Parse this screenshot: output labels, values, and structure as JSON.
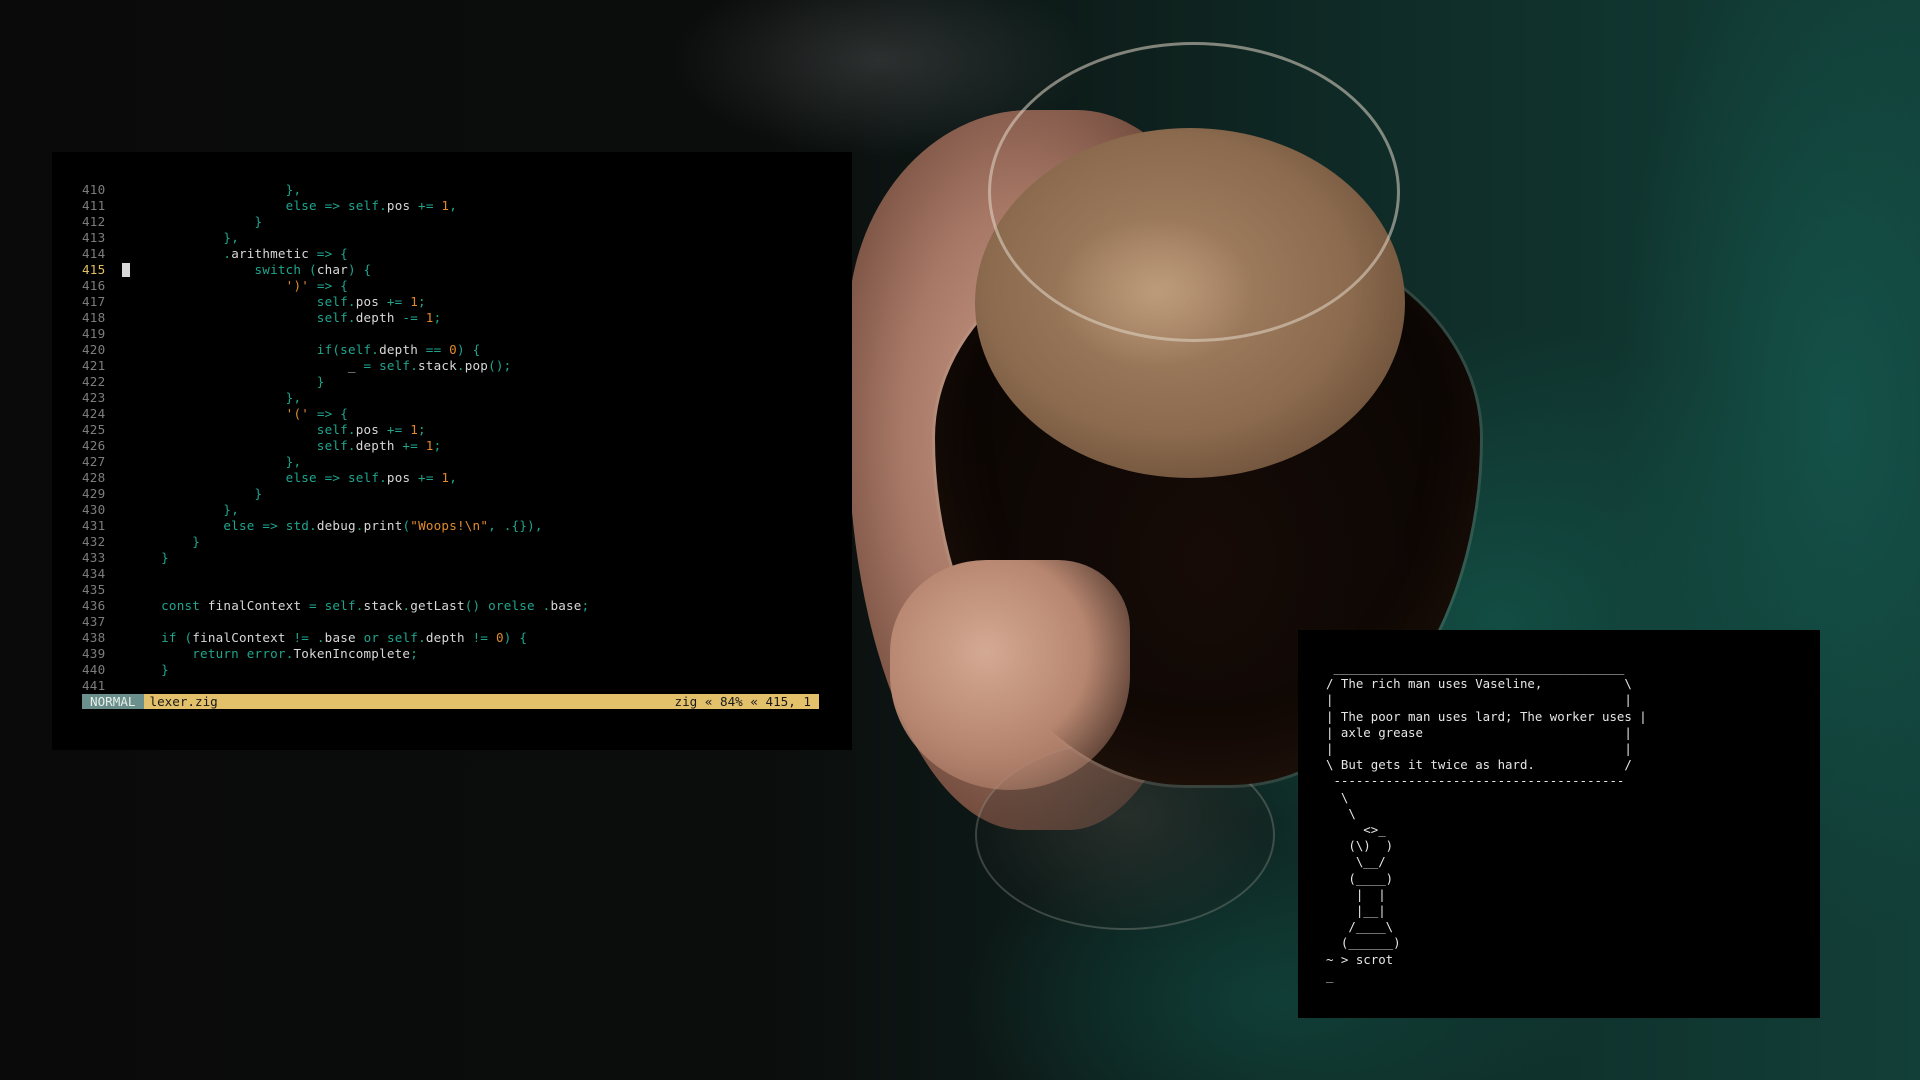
{
  "editor": {
    "mode": "NORMAL",
    "filename": "lexer.zig",
    "position": "zig « 84% « 415, 1",
    "current_line": 415,
    "lines": [
      {
        "n": "410",
        "t": "                    },"
      },
      {
        "n": "411",
        "t": "                    else => self.pos += 1,"
      },
      {
        "n": "412",
        "t": "                }"
      },
      {
        "n": "413",
        "t": "            },"
      },
      {
        "n": "414",
        "t": "            .arithmetic => {"
      },
      {
        "n": "415",
        "t": "                switch (char) {"
      },
      {
        "n": "416",
        "t": "                    ')' => {"
      },
      {
        "n": "417",
        "t": "                        self.pos += 1;"
      },
      {
        "n": "418",
        "t": "                        self.depth -= 1;"
      },
      {
        "n": "419",
        "t": ""
      },
      {
        "n": "420",
        "t": "                        if(self.depth == 0) {"
      },
      {
        "n": "421",
        "t": "                            _ = self.stack.pop();"
      },
      {
        "n": "422",
        "t": "                        }"
      },
      {
        "n": "423",
        "t": "                    },"
      },
      {
        "n": "424",
        "t": "                    '(' => {"
      },
      {
        "n": "425",
        "t": "                        self.pos += 1;"
      },
      {
        "n": "426",
        "t": "                        self.depth += 1;"
      },
      {
        "n": "427",
        "t": "                    },"
      },
      {
        "n": "428",
        "t": "                    else => self.pos += 1,"
      },
      {
        "n": "429",
        "t": "                }"
      },
      {
        "n": "430",
        "t": "            },"
      },
      {
        "n": "431",
        "t": "            else => std.debug.print(\"Woops!\\n\", .{}),"
      },
      {
        "n": "432",
        "t": "        }"
      },
      {
        "n": "433",
        "t": "    }"
      },
      {
        "n": "434",
        "t": ""
      },
      {
        "n": "435",
        "t": ""
      },
      {
        "n": "436",
        "t": "    const finalContext = self.stack.getLast() orelse .base;"
      },
      {
        "n": "437",
        "t": ""
      },
      {
        "n": "438",
        "t": "    if (finalContext != .base or self.depth != 0) {"
      },
      {
        "n": "439",
        "t": "        return error.TokenIncomplete;"
      },
      {
        "n": "440",
        "t": "    }"
      },
      {
        "n": "441",
        "t": ""
      }
    ]
  },
  "shell": {
    "output": " _______________________________________\n/ The rich man uses Vaseline,           \\\n|                                       |\n| The poor man uses lard; The worker uses |\n| axle grease                           |\n|                                       |\n\\ But gets it twice as hard.            /\n ---------------------------------------\n  \\\n   \\\n     <>_\n   (\\)  )\n    \\__/\n   (____)\n    |  |\n    |__|\n   /____\\\n  (______)",
    "prompt": "~ > scrot",
    "cursor": "_"
  },
  "colors": {
    "keyword": "#1fa58e",
    "number": "#e08a2c",
    "statusbar": "#e3c06a",
    "mode": "#6a8f8c"
  }
}
